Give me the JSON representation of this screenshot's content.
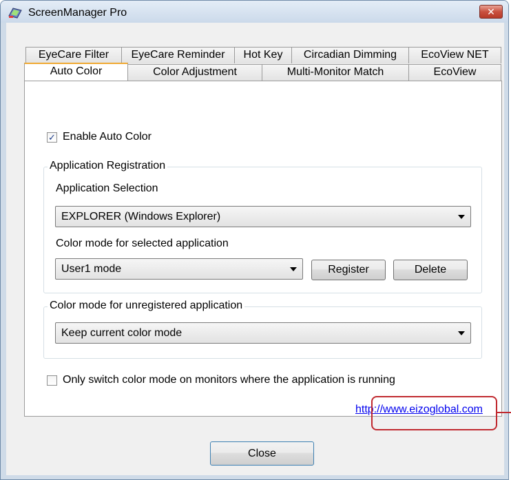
{
  "window": {
    "title": "ScreenManager Pro",
    "close_symbol": "✕"
  },
  "tabs_row1": [
    "EyeCare Filter",
    "EyeCare Reminder",
    "Hot Key",
    "Circadian Dimming",
    "EcoView NET"
  ],
  "tabs_row2": [
    "Auto Color",
    "Color Adjustment",
    "Multi-Monitor Match",
    "EcoView"
  ],
  "active_tab": "Auto Color",
  "auto_color": {
    "enable_label": "Enable Auto Color",
    "enable_checked": true,
    "app_registration": {
      "title": "Application Registration",
      "selection_label": "Application Selection",
      "selection_value": "EXPLORER (Windows Explorer)",
      "color_mode_label": "Color mode for selected application",
      "color_mode_value": "User1 mode",
      "register_label": "Register",
      "delete_label": "Delete"
    },
    "unregistered": {
      "title": "Color mode for unregistered application",
      "value": "Keep current color mode"
    },
    "only_switch_label": "Only switch color mode on monitors where the application is running",
    "only_switch_checked": false,
    "link": "http://www.eizoglobal.com"
  },
  "close_button_label": "Close",
  "colors": {
    "highlight": "#c0282e",
    "tab_accent": "#f0a830",
    "link": "#0000ee"
  }
}
